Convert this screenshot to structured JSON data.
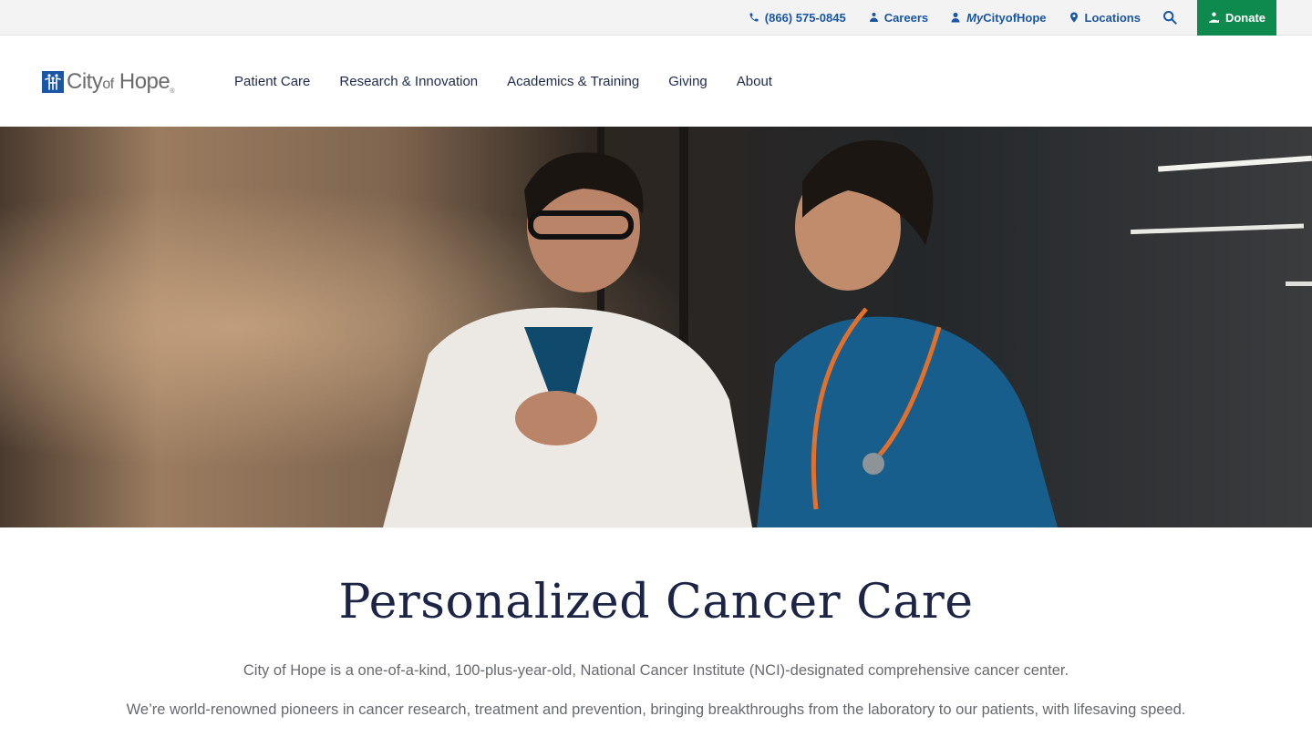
{
  "utility_bar": {
    "phone": "(866) 575-0845",
    "careers": "Careers",
    "my_prefix": "My",
    "my_suffix": "CityofHope",
    "locations": "Locations",
    "donate": "Donate"
  },
  "logo": {
    "city": "City",
    "of": "of",
    "hope": "Hope",
    "reg": "®"
  },
  "nav": [
    "Patient Care",
    "Research & Innovation",
    "Academics & Training",
    "Giving",
    "About"
  ],
  "intro": {
    "title": "Personalized Cancer Care",
    "paragraph_1": "City of Hope is a one-of-a-kind, 100-plus-year-old, National Cancer Institute (NCI)-designated comprehensive cancer center.",
    "paragraph_2": "We’re world-renowned pioneers in cancer research, treatment and prevention, bringing breakthroughs from the laboratory to our patients, with lifesaving speed."
  },
  "colors": {
    "link_blue": "#1a56a6",
    "donate_green": "#0f8a4f",
    "heading_navy": "#1d2547",
    "body_gray": "#666a70"
  }
}
